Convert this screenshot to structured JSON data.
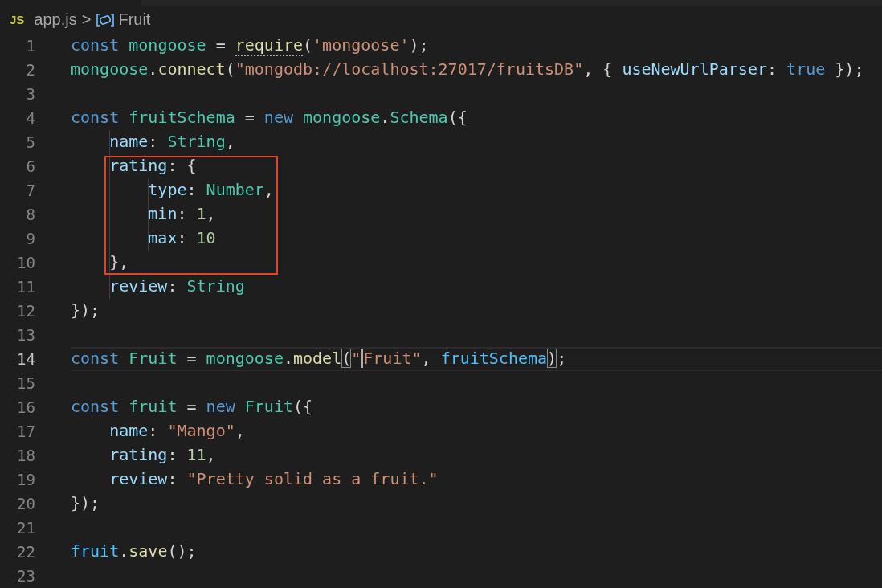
{
  "breadcrumb": {
    "language_badge": "JS",
    "file": "app.js",
    "separator": ">",
    "symbol": "Fruit"
  },
  "blocks": [
    {
      "boxed": false,
      "lines": [
        {
          "number": "1",
          "current": false,
          "tokens": [
            {
              "text": "const",
              "kind": "keyword"
            },
            {
              "text": " mongoose",
              "kind": "variable"
            },
            {
              "text": " = ",
              "kind": "plain"
            },
            {
              "text": "require",
              "kind": "function",
              "hint": true
            },
            {
              "text": "(",
              "kind": "plain"
            },
            {
              "text": "'mongoose'",
              "kind": "string"
            },
            {
              "text": ");",
              "kind": "plain"
            }
          ]
        },
        {
          "number": "2",
          "current": false,
          "tokens": [
            {
              "text": "mongoose",
              "kind": "variable"
            },
            {
              "text": ".",
              "kind": "plain"
            },
            {
              "text": "connect",
              "kind": "function"
            },
            {
              "text": "(",
              "kind": "plain"
            },
            {
              "text": "\"mongodb://localhost:27017/fruitsDB\"",
              "kind": "string"
            },
            {
              "text": ", { ",
              "kind": "plain"
            },
            {
              "text": "useNewUrlParser",
              "kind": "property"
            },
            {
              "text": ": ",
              "kind": "plain"
            },
            {
              "text": "true",
              "kind": "keyword"
            },
            {
              "text": " });",
              "kind": "plain"
            }
          ]
        },
        {
          "number": "3",
          "current": false
        },
        {
          "number": "4",
          "current": false,
          "tokens": [
            {
              "text": "const",
              "kind": "keyword"
            },
            {
              "text": " fruitSchema",
              "kind": "variable"
            },
            {
              "text": " = ",
              "kind": "plain"
            },
            {
              "text": "new",
              "kind": "keyword"
            },
            {
              "text": " mongoose",
              "kind": "variable"
            },
            {
              "text": ".",
              "kind": "plain"
            },
            {
              "text": "Schema",
              "kind": "class"
            },
            {
              "text": "({",
              "kind": "plain"
            }
          ]
        },
        {
          "number": "5",
          "current": false,
          "tokens": [
            {
              "text": "    name",
              "kind": "property"
            },
            {
              "text": ": ",
              "kind": "plain"
            },
            {
              "text": "String",
              "kind": "class"
            },
            {
              "text": ",",
              "kind": "plain"
            }
          ]
        }
      ]
    },
    {
      "boxed": true,
      "lines": [
        {
          "number": "6",
          "current": false,
          "tokens": [
            {
              "text": "    rating",
              "kind": "property"
            },
            {
              "text": ": {",
              "kind": "plain"
            }
          ]
        },
        {
          "number": "7",
          "current": false,
          "tokens": [
            {
              "text": "        type",
              "kind": "property"
            },
            {
              "text": ": ",
              "kind": "plain"
            },
            {
              "text": "Number",
              "kind": "class"
            },
            {
              "text": ",",
              "kind": "plain"
            }
          ]
        },
        {
          "number": "8",
          "current": false,
          "tokens": [
            {
              "text": "        min",
              "kind": "property"
            },
            {
              "text": ": ",
              "kind": "plain"
            },
            {
              "text": "1",
              "kind": "number"
            },
            {
              "text": ",",
              "kind": "plain"
            }
          ]
        },
        {
          "number": "9",
          "current": false,
          "tokens": [
            {
              "text": "        max",
              "kind": "property"
            },
            {
              "text": ": ",
              "kind": "plain"
            },
            {
              "text": "10",
              "kind": "number"
            }
          ]
        },
        {
          "number": "10",
          "current": false,
          "tokens": [
            {
              "text": "    },",
              "kind": "plain"
            }
          ]
        }
      ]
    },
    {
      "boxed": false,
      "lines": [
        {
          "number": "11",
          "current": false,
          "tokens": [
            {
              "text": "    review",
              "kind": "property"
            },
            {
              "text": ": ",
              "kind": "plain"
            },
            {
              "text": "String",
              "kind": "class"
            }
          ]
        },
        {
          "number": "12",
          "current": false,
          "tokens": [
            {
              "text": "});",
              "kind": "plain"
            }
          ]
        },
        {
          "number": "13",
          "current": false
        },
        {
          "number": "14",
          "current": true,
          "tokens": [
            {
              "text": "const",
              "kind": "keyword"
            },
            {
              "text": " Fruit",
              "kind": "variable"
            },
            {
              "text": " = ",
              "kind": "plain"
            },
            {
              "text": "mongoose",
              "kind": "variable"
            },
            {
              "text": ".",
              "kind": "plain"
            },
            {
              "text": "model",
              "kind": "function"
            },
            {
              "text": "(",
              "kind": "plain",
              "matched": true
            },
            {
              "text": "\"",
              "kind": "string"
            },
            {
              "text": "Fruit\"",
              "kind": "string",
              "cursor": true
            },
            {
              "text": ", ",
              "kind": "plain"
            },
            {
              "text": "fruitSchema",
              "kind": "parameter"
            },
            {
              "text": ")",
              "kind": "plain",
              "matched": true
            },
            {
              "text": ";",
              "kind": "plain"
            }
          ]
        },
        {
          "number": "15",
          "current": false
        },
        {
          "number": "16",
          "current": false,
          "tokens": [
            {
              "text": "const",
              "kind": "keyword"
            },
            {
              "text": " fruit",
              "kind": "variable"
            },
            {
              "text": " = ",
              "kind": "plain"
            },
            {
              "text": "new",
              "kind": "keyword"
            },
            {
              "text": " Fruit",
              "kind": "class"
            },
            {
              "text": "({",
              "kind": "plain"
            }
          ]
        },
        {
          "number": "17",
          "current": false,
          "tokens": [
            {
              "text": "    name",
              "kind": "property"
            },
            {
              "text": ": ",
              "kind": "plain"
            },
            {
              "text": "\"Mango\"",
              "kind": "string"
            },
            {
              "text": ",",
              "kind": "plain"
            }
          ]
        },
        {
          "number": "18",
          "current": false,
          "tokens": [
            {
              "text": "    rating",
              "kind": "property"
            },
            {
              "text": ": ",
              "kind": "plain"
            },
            {
              "text": "11",
              "kind": "number"
            },
            {
              "text": ",",
              "kind": "plain"
            }
          ]
        },
        {
          "number": "19",
          "current": false,
          "tokens": [
            {
              "text": "    review",
              "kind": "property"
            },
            {
              "text": ": ",
              "kind": "plain"
            },
            {
              "text": "\"Pretty solid as a fruit.\"",
              "kind": "string"
            }
          ]
        },
        {
          "number": "20",
          "current": false,
          "tokens": [
            {
              "text": "});",
              "kind": "plain"
            }
          ]
        },
        {
          "number": "21",
          "current": false
        },
        {
          "number": "22",
          "current": false,
          "tokens": [
            {
              "text": "fruit",
              "kind": "parameter"
            },
            {
              "text": ".",
              "kind": "plain"
            },
            {
              "text": "save",
              "kind": "function"
            },
            {
              "text": "();",
              "kind": "plain"
            }
          ]
        },
        {
          "number": "23",
          "current": false
        }
      ]
    }
  ]
}
